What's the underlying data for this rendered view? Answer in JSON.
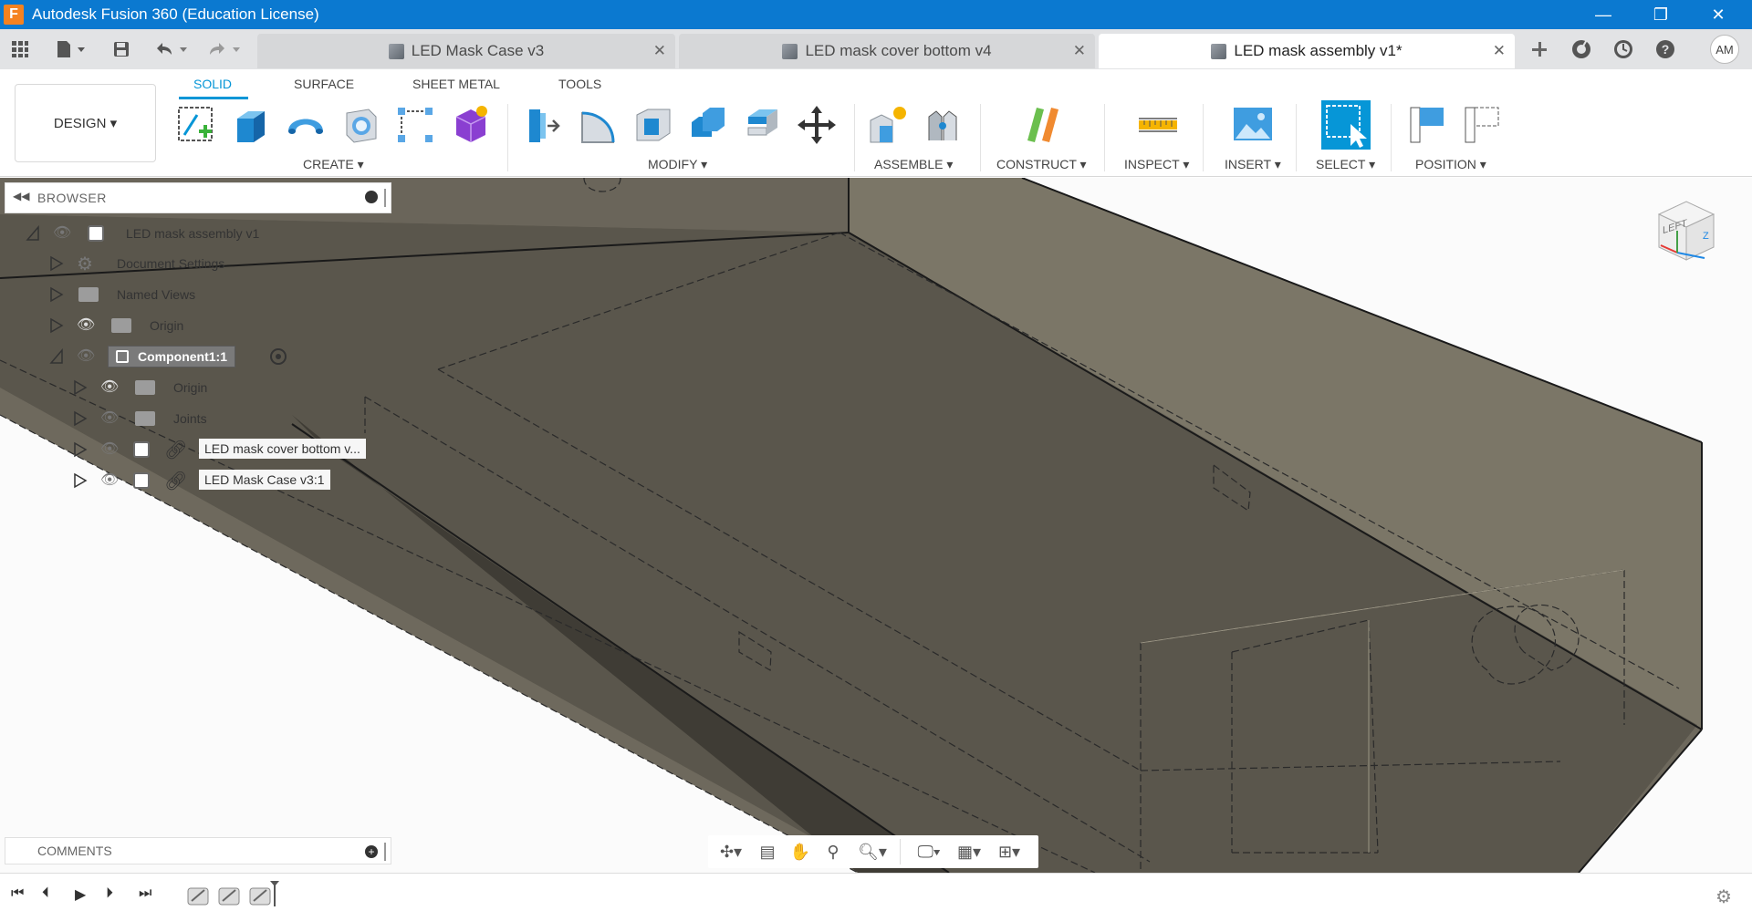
{
  "window": {
    "title": "Autodesk Fusion 360 (Education License)",
    "logo_letter": "F",
    "minimize": "—",
    "restore": "❐",
    "close": "✕"
  },
  "tabs": [
    {
      "label": "LED Mask Case v3",
      "close": "✕"
    },
    {
      "label": "LED mask cover bottom v4",
      "close": "✕"
    },
    {
      "label": "LED mask assembly v1*",
      "close": "✕"
    }
  ],
  "user": {
    "initials": "AM"
  },
  "workspace": {
    "label": "DESIGN ▾"
  },
  "ribbon_tabs": [
    "SOLID",
    "SURFACE",
    "SHEET METAL",
    "TOOLS"
  ],
  "ribbon_groups": [
    "CREATE ▾",
    "MODIFY ▾",
    "ASSEMBLE ▾",
    "CONSTRUCT ▾",
    "INSPECT ▾",
    "INSERT ▾",
    "SELECT ▾",
    "POSITION ▾"
  ],
  "browser": {
    "title": "BROWSER",
    "items": [
      {
        "label": "LED mask assembly v1"
      },
      {
        "label": "Document Settings"
      },
      {
        "label": "Named Views"
      },
      {
        "label": "Origin"
      },
      {
        "label": "Component1:1"
      },
      {
        "label": "Origin"
      },
      {
        "label": "Joints"
      },
      {
        "label": "LED mask cover bottom v..."
      },
      {
        "label": "LED Mask Case v3:1"
      }
    ]
  },
  "comments": {
    "title": "COMMENTS"
  },
  "viewcube": {
    "face": "LEFT",
    "axis": "Z"
  },
  "colors": {
    "titlebar": "#0b79d0",
    "accent": "#0696d7",
    "model": "#6e695d"
  }
}
